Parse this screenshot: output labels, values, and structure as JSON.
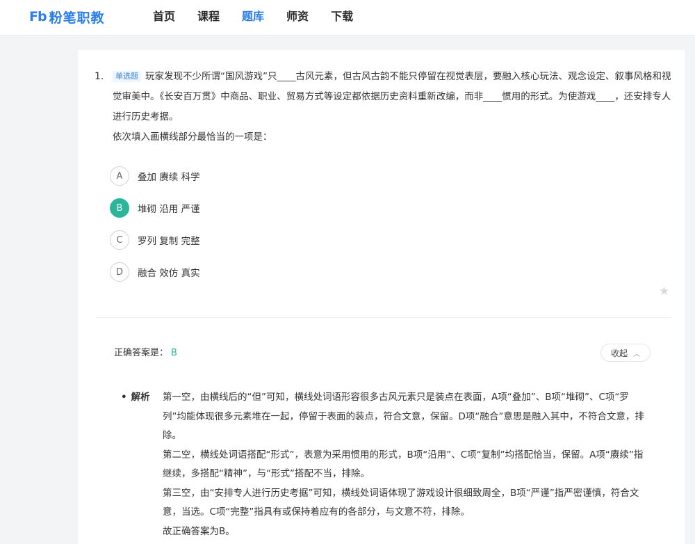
{
  "brand": {
    "logo_mark": "Fb",
    "name": "粉笔职教"
  },
  "nav": {
    "items": [
      "首页",
      "课程",
      "题库",
      "师资",
      "下载"
    ],
    "active": "题库"
  },
  "question": {
    "number": "1.",
    "type_badge": "单选题",
    "stem": "玩家发现不少所谓“国风游戏”只____古风元素，但古风古韵不能只停留在视觉表层，要融入核心玩法、观念设定、叙事风格和视觉审美中。《长安百万贯》中商品、职业、贸易方式等设定都依据历史资料重新改编，而非____惯用的形式。为使游戏____，还安排专人进行历史考据。",
    "prompt": "依次填入画横线部分最恰当的一项是：",
    "options": [
      {
        "letter": "A",
        "text": "叠加 赓续 科学"
      },
      {
        "letter": "B",
        "text": "堆砌 沿用 严谨"
      },
      {
        "letter": "C",
        "text": "罗列 复制 完整"
      },
      {
        "letter": "D",
        "text": "融合 效仿 真实"
      }
    ],
    "selected_letter": "B"
  },
  "answer": {
    "label": "正确答案是：",
    "value": "B",
    "collapse_label": "收起"
  },
  "analysis": {
    "label": "解析",
    "paragraphs": [
      "第一空，由横线后的“但”可知，横线处词语形容很多古风元素只是装点在表面，A项“叠加”、B项“堆砌”、C项“罗列”均能体现很多元素堆在一起，停留于表面的装点，符合文意，保留。D项“融合”意思是融入其中，不符合文意，排除。",
      "第二空，横线处词语搭配“形式”，表意为采用惯用的形式，B项“沿用”、C项“复制”均搭配恰当，保留。A项“赓续”指继续，多搭配“精神”，与“形式”搭配不当，排除。",
      "第三空，由“安排专人进行历史考据”可知，横线处词语体现了游戏设计很细致周全，B项“严谨”指严密谨慎，符合文意，当选。C项“完整”指具有或保持着应有的各部分，与文意不符，排除。",
      "故正确答案为B。"
    ]
  },
  "colors": {
    "brand_blue": "#2b7de9",
    "correct_green": "#2bb59a"
  }
}
